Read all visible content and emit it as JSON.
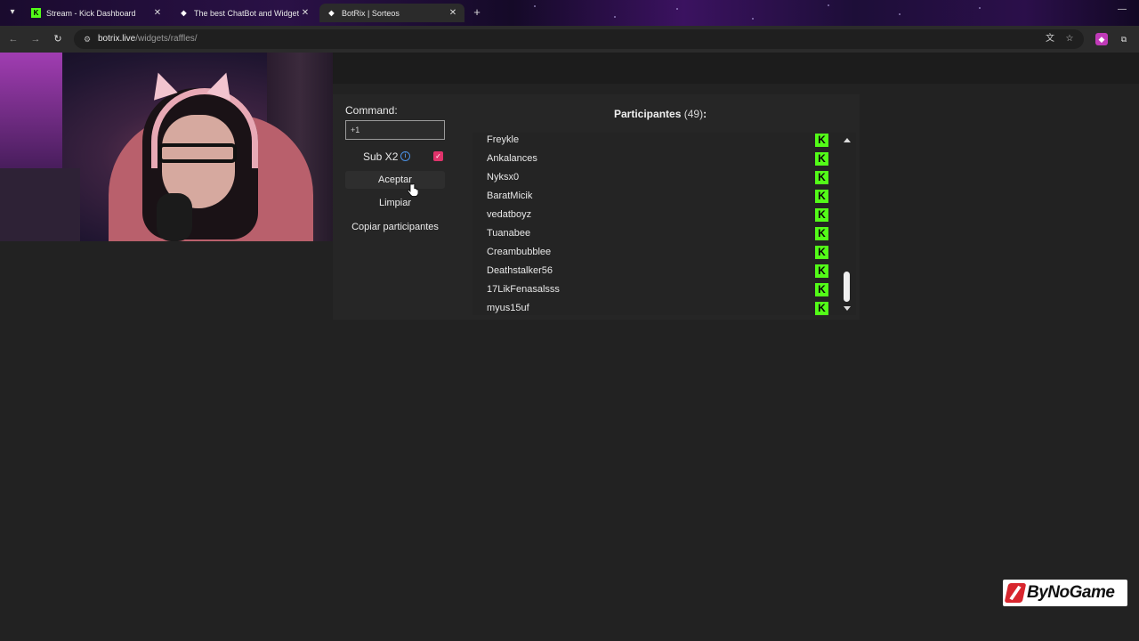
{
  "browser": {
    "tabs": [
      {
        "title": "Stream - Kick Dashboard",
        "favicon": "kick-icon",
        "active": false
      },
      {
        "title": "The best ChatBot and Widgets",
        "favicon": "botrix-icon",
        "active": false
      },
      {
        "title": "BotRix | Sorteos",
        "favicon": "botrix-icon",
        "active": true
      }
    ],
    "url_host": "botrix.live",
    "url_path": "/widgets/raffles/"
  },
  "raffle": {
    "command_label": "Command:",
    "command_value": "+1",
    "sub_label": "Sub X2",
    "sub_checked": true,
    "accept_label": "Aceptar",
    "clear_label": "Limpiar",
    "copy_label": "Copiar participantes"
  },
  "participants": {
    "title": "Participantes",
    "count": "(49)",
    "colon": ":",
    "items": [
      {
        "name": "Freykle"
      },
      {
        "name": "Ankalances"
      },
      {
        "name": "Nyksx0"
      },
      {
        "name": "BaratMicik"
      },
      {
        "name": "vedatboyz"
      },
      {
        "name": "Tuanabee"
      },
      {
        "name": "Creambubblee"
      },
      {
        "name": "Deathstalker56"
      },
      {
        "name": "17LikFenasalsss"
      },
      {
        "name": "myus15uf"
      }
    ],
    "platform_icon": "kick-icon",
    "platform_color": "#53fc18"
  },
  "watermark": {
    "text": "ByNoGame"
  },
  "colors": {
    "accent_check": "#e0336b",
    "info": "#4a90e2",
    "kick": "#53fc18"
  }
}
